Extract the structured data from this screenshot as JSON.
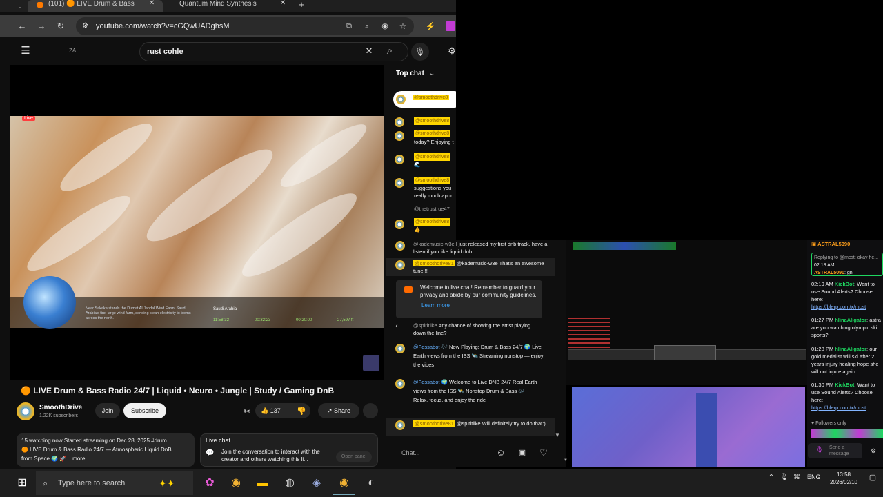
{
  "browser": {
    "tabs": [
      {
        "label": "(101) 🟠 LIVE Drum & Bass",
        "active": true
      },
      {
        "label": "Quantum Mind Synthesis",
        "active": false
      }
    ],
    "url": "youtube.com/watch?v=cGQwUADghsM"
  },
  "youtube": {
    "logo_text": "ZA",
    "search_value": "rust cohle",
    "live_badge": "Live",
    "video_title": "🟠 LIVE Drum & Bass Radio 24/7 | Liquid • Neuro • Jungle | Study / Gaming DnB",
    "channel_name": "SmoothDrive",
    "subscribers": "1.22K subscribers",
    "join_label": "Join",
    "subscribe_label": "Subscribe",
    "like_count": "137",
    "share_label": "Share",
    "overlay": {
      "caption": "Near Sakaka stands the Dumat Al Jandal Wind Farm, Saudi Arabia's first large wind farm, sending clean electricity to towns across the north.",
      "location_label": "Saudi Arabia",
      "stats": [
        {
          "label": "LOCAL",
          "value": "11:58:32"
        },
        {
          "label": "SUNSET",
          "value": "00:32:23"
        },
        {
          "label": "NEXT ISS",
          "value": "00:20:00"
        },
        {
          "label": "ORBIT",
          "value": "27,597 ft"
        }
      ]
    },
    "description": {
      "line1": "15 watching now  Started streaming on Dec 28, 2025  #drum",
      "line2": "🟠 LIVE Drum & Bass Radio 24/7 — Atmospheric Liquid DnB",
      "line3": "from Space 🌍 🚀  ...more"
    },
    "live_chat_box": {
      "title": "Live chat",
      "text": "Join the conversation to interact with the creator and others watching this li...",
      "button": "Open panel"
    }
  },
  "chat": {
    "header": "Top chat",
    "pinned_user": "@smoothdrive8",
    "messages": [
      {
        "user": "@smoothdrive8",
        "text": "",
        "top_offset": 0
      },
      {
        "user": "@smoothdrive8",
        "text": "today? Enjoying t"
      },
      {
        "user": "@smoothdrive8",
        "text": "🌊"
      },
      {
        "user": "@smoothdrive8",
        "text": "suggestions you really much appr"
      },
      {
        "user": "@thetrustrue47",
        "text": ""
      },
      {
        "user": "@smoothdrive8",
        "text": "👍"
      }
    ],
    "messages2": [
      {
        "user": "@kademusic-w3e",
        "text": "I just released my first dnb track, have a listen if you like liquid dnb:"
      },
      {
        "user": "@smoothdrive81",
        "text": "@kademusic-w3e That's an awesome tune!!!"
      },
      {
        "user": "@spiritlike",
        "text": "Any chance of showing the artist playing down the line?"
      },
      {
        "user": "@Fossabot",
        "text": "🎶 Now Playing: Drum & Bass 24/7 🌍 Live Earth views from the ISS 🛰️ Streaming nonstop — enjoy the vibes"
      },
      {
        "user": "@Fossabot",
        "text": "🌍 Welcome to Live DNB 24/7 Real Earth views from the ISS 🛰️ Nonstop Drum & Bass 🎶 Relax, focus, and enjoy the ride"
      },
      {
        "user": "@smoothdrive81",
        "text": "@spiritlike Will definitely try to do that:)"
      }
    ],
    "welcome": {
      "text": "Welcome to live chat! Remember to guard your privacy and abide by our community guidelines.",
      "link": "Learn more"
    },
    "input_placeholder": "Chat..."
  },
  "twitch": {
    "messages": [
      {
        "time": "",
        "user": "ASTRAL5090",
        "text": ""
      },
      {
        "time": "",
        "user": "",
        "text": "Replying to @mcst: okay he..."
      },
      {
        "time": "02:18 AM",
        "user": "ASTRAL5090",
        "text": ": gn"
      },
      {
        "time": "02:19 AM",
        "user": "KickBot",
        "text": ": Want to use Sound Alerts? Choose here:",
        "link": "https://blerp.com/x/mcst"
      },
      {
        "time": "01:27 PM",
        "user": "hlinaAligator",
        "text": ": astra are you watching olympic ski sports?"
      },
      {
        "time": "01:28 PM",
        "user": "hlinaAligator",
        "text": ": our gold medalist will ski after 2 years injury healing hope she will not injure again"
      },
      {
        "time": "01:30 PM",
        "user": "KickBot",
        "text": ": Want to use Sound Alerts? Choose here:",
        "link": "https://blerp.com/x/mcst"
      }
    ],
    "followers_only": "Followers only",
    "send_placeholder": "Send a message"
  },
  "taskbar": {
    "search_placeholder": "Type here to search",
    "language": "ENG",
    "time": "13:58",
    "date": "2026/02/10"
  },
  "colors": {
    "accent_red": "#ff0000",
    "chat_highlight": "#ffd600",
    "twitch_green": "#1ed760"
  }
}
